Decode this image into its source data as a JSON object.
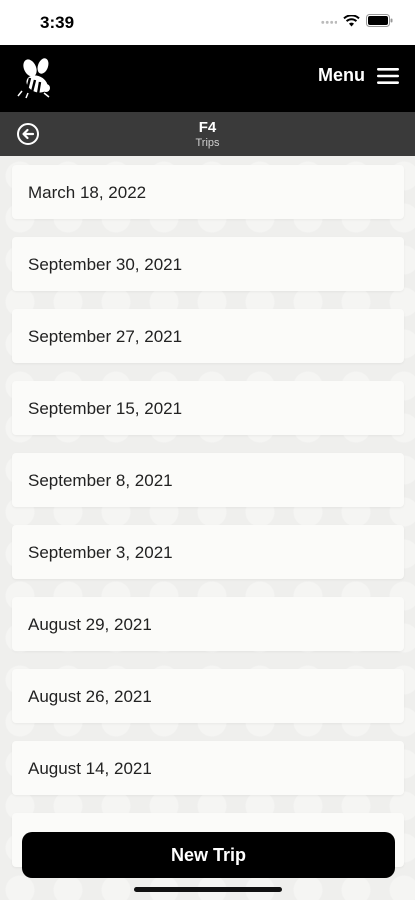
{
  "status_bar": {
    "time": "3:39"
  },
  "header": {
    "menu_label": "Menu"
  },
  "sub_header": {
    "title": "F4",
    "subtitle": "Trips"
  },
  "trips": [
    "March 18, 2022",
    "September 30, 2021",
    "September 27, 2021",
    "September 15, 2021",
    "September 8, 2021",
    "September 3, 2021",
    "August 29, 2021",
    "August 26, 2021",
    "August 14, 2021"
  ],
  "actions": {
    "new_trip_label": "New Trip"
  },
  "icons": {
    "logo": "bee-logo-icon",
    "menu": "hamburger-menu-icon",
    "back": "back-arrow-circle-icon",
    "signal": "signal-icon",
    "wifi": "wifi-icon",
    "battery": "battery-icon"
  }
}
